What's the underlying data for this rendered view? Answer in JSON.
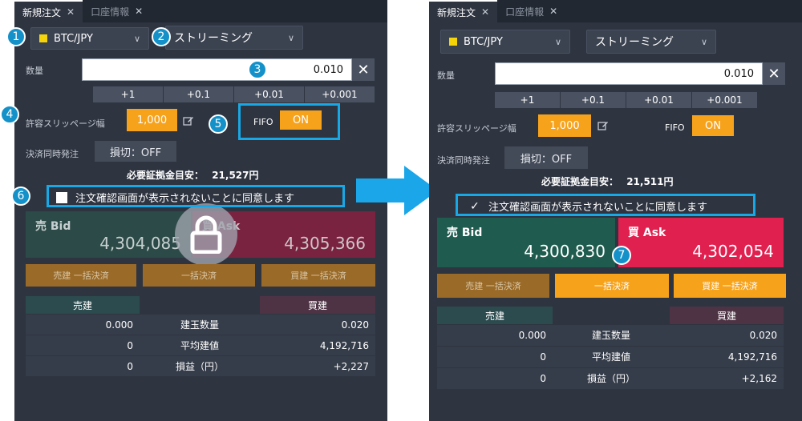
{
  "tabs": [
    {
      "label": "新規注文",
      "close": "✕"
    },
    {
      "label": "口座情報",
      "close": "✕"
    }
  ],
  "symbol": "BTC/JPY",
  "stream_mode": "ストリーミング",
  "quantity": {
    "label": "数量",
    "value": "0.010",
    "clear": "✕",
    "steps": [
      "+1",
      "+0.1",
      "+0.01",
      "+0.001"
    ]
  },
  "slippage": {
    "label": "許容スリッページ幅",
    "value": "1,000"
  },
  "fifo": {
    "label": "FIFO",
    "value": "ON"
  },
  "simultaneous": {
    "label": "決済同時発注",
    "value": "損切：OFF"
  },
  "margin": {
    "label": "必要証拠金目安：",
    "left_value": "21,527円",
    "right_value": "21,511円"
  },
  "agree_text": "注文確認画面が表示されないことに同意します",
  "bid": {
    "label": "売 Bid",
    "left_price": "4,304,085",
    "right_price": "4,300,830"
  },
  "ask": {
    "label": "買 Ask",
    "left_price": "4,305,366",
    "right_price": "4,302,054"
  },
  "actions": [
    "売建 一括決済",
    "一括決済",
    "買建 一括決済"
  ],
  "positions": {
    "sell_header": "売建",
    "buy_header": "買建",
    "rows": [
      {
        "sell": "0.000",
        "label": "建玉数量",
        "buy": "0.020",
        "buy_right": "0.020"
      },
      {
        "sell": "0",
        "label": "平均建値",
        "buy": "4,192,716",
        "buy_right": "4,192,716"
      },
      {
        "sell": "0",
        "label": "損益（円）",
        "buy": "+2,227",
        "buy_right": "+2,162"
      }
    ]
  },
  "callout_numbers": [
    "1",
    "2",
    "3",
    "4",
    "5",
    "6",
    "7"
  ],
  "colors": {
    "accent_orange": "#f7a21b",
    "bid_green": "#1f5c4f",
    "ask_red": "#e0204f",
    "callout_blue": "#18a8e6"
  }
}
